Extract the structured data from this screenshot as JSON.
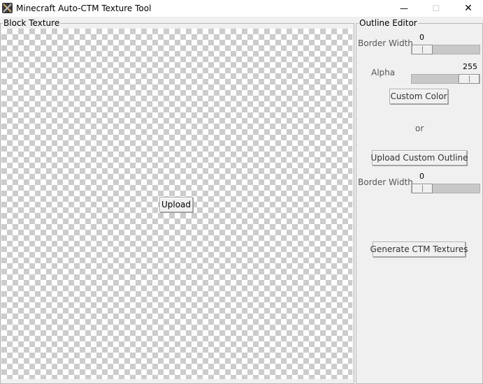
{
  "window": {
    "title": "Minecraft Auto-CTM Texture Tool",
    "minimize_glyph": "—",
    "maximize_glyph": "☐",
    "close_glyph": "✕"
  },
  "block_texture": {
    "frame_label": "Block Texture",
    "upload_label": "Upload"
  },
  "outline_editor": {
    "frame_label": "Outline Editor",
    "border_width_label": "Border Width",
    "border_width_value": "0",
    "alpha_label": "Alpha",
    "alpha_value": "255",
    "custom_color_label": "Custom Color",
    "or_label": "or",
    "upload_outline_label": "Upload Custom Outline",
    "custom_border_width_label": "Border Width",
    "custom_border_width_value": "0",
    "generate_label": "Generate CTM Textures"
  },
  "sliders": {
    "border_width_level": 0,
    "alpha_level": 1,
    "custom_border_width_level": 0
  },
  "icons": [
    "app-icon",
    "minimize-icon",
    "maximize-icon",
    "close-icon"
  ]
}
